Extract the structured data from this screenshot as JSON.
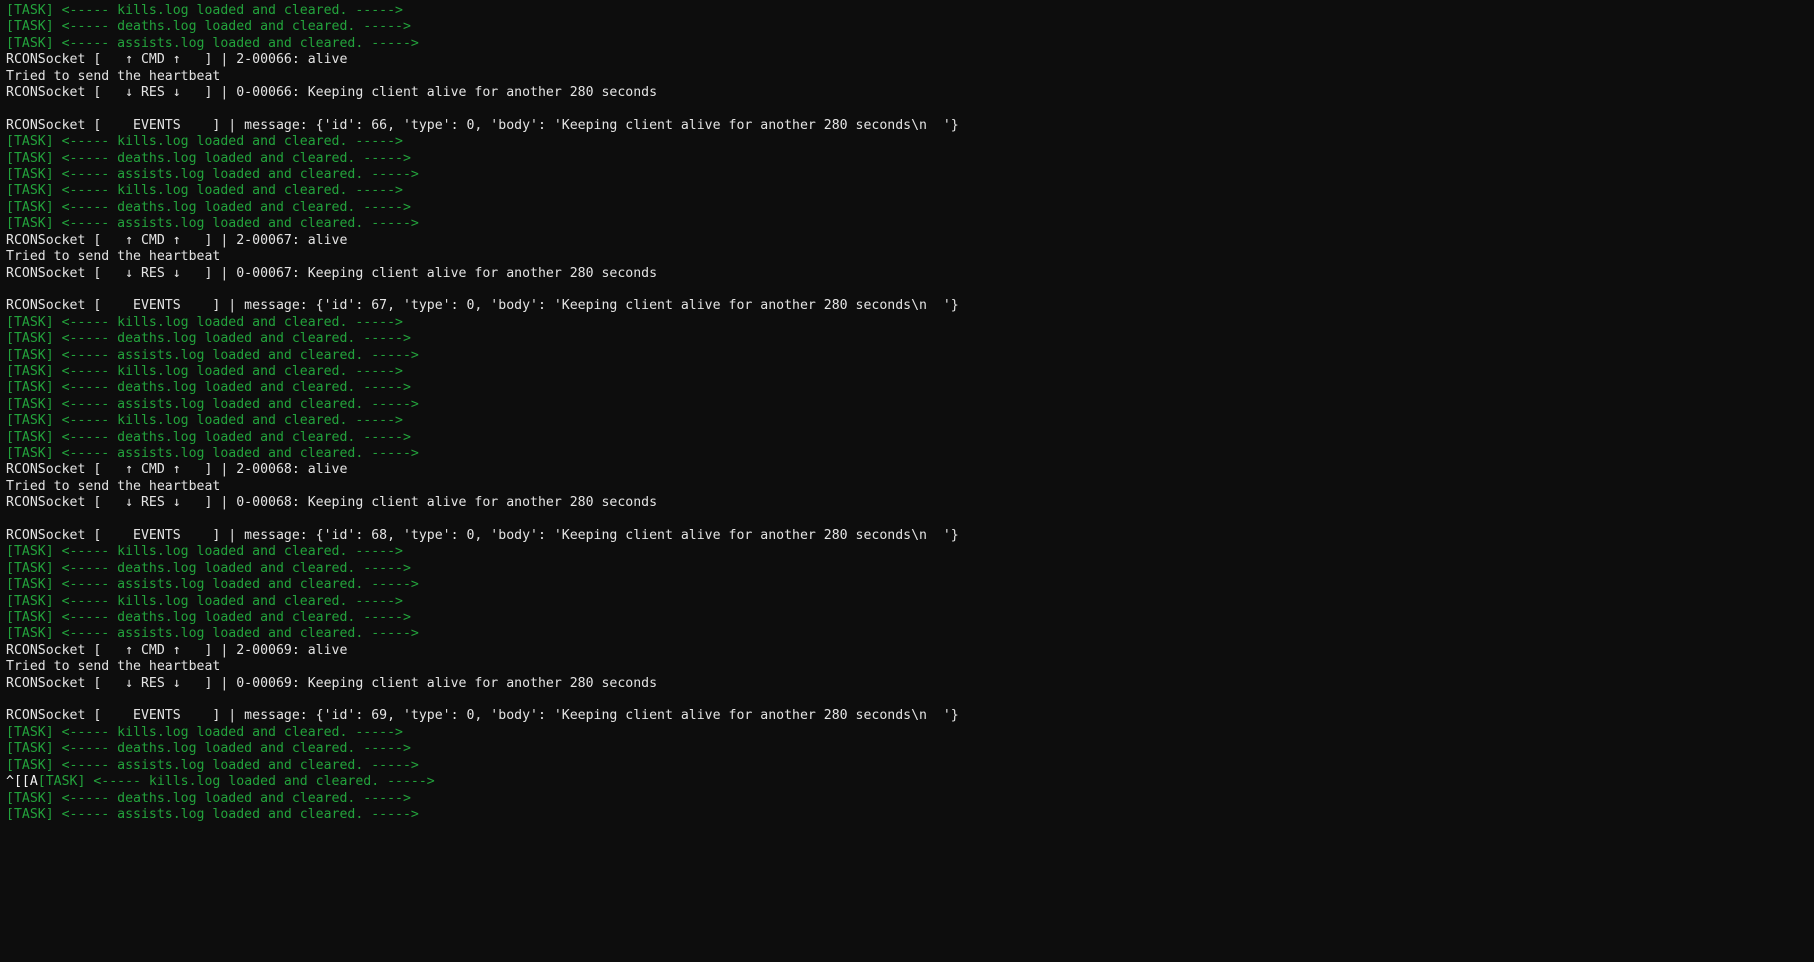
{
  "terminal": {
    "background_color": "#0d0d0d",
    "task_color": "#23a33c",
    "plain_color": "#e4e4e4",
    "escape_color": "#f2f2f2",
    "font_size_px": 13.2,
    "line_height_px": 16.42,
    "columns_visible": 120,
    "rows_visible": 59
  },
  "lines": [
    {
      "type": "task",
      "text": "[TASK] <----- kills.log loaded and cleared. ----->"
    },
    {
      "type": "task",
      "text": "[TASK] <----- deaths.log loaded and cleared. ----->"
    },
    {
      "type": "task",
      "text": "[TASK] <----- assists.log loaded and cleared. ----->"
    },
    {
      "type": "plain",
      "text": "RCONSocket [   ↑ CMD ↑   ] | 2-00066: alive"
    },
    {
      "type": "plain",
      "text": "Tried to send the heartbeat"
    },
    {
      "type": "plain",
      "text": "RCONSocket [   ↓ RES ↓   ] | 0-00066: Keeping client alive for another 280 seconds"
    },
    {
      "type": "blank",
      "text": ""
    },
    {
      "type": "plain",
      "text": "RCONSocket [    EVENTS    ] | message: {'id': 66, 'type': 0, 'body': 'Keeping client alive for another 280 seconds\\n  '}"
    },
    {
      "type": "task",
      "text": "[TASK] <----- kills.log loaded and cleared. ----->"
    },
    {
      "type": "task",
      "text": "[TASK] <----- deaths.log loaded and cleared. ----->"
    },
    {
      "type": "task",
      "text": "[TASK] <----- assists.log loaded and cleared. ----->"
    },
    {
      "type": "task",
      "text": "[TASK] <----- kills.log loaded and cleared. ----->"
    },
    {
      "type": "task",
      "text": "[TASK] <----- deaths.log loaded and cleared. ----->"
    },
    {
      "type": "task",
      "text": "[TASK] <----- assists.log loaded and cleared. ----->"
    },
    {
      "type": "plain",
      "text": "RCONSocket [   ↑ CMD ↑   ] | 2-00067: alive"
    },
    {
      "type": "plain",
      "text": "Tried to send the heartbeat"
    },
    {
      "type": "plain",
      "text": "RCONSocket [   ↓ RES ↓   ] | 0-00067: Keeping client alive for another 280 seconds"
    },
    {
      "type": "blank",
      "text": ""
    },
    {
      "type": "plain",
      "text": "RCONSocket [    EVENTS    ] | message: {'id': 67, 'type': 0, 'body': 'Keeping client alive for another 280 seconds\\n  '}"
    },
    {
      "type": "task",
      "text": "[TASK] <----- kills.log loaded and cleared. ----->"
    },
    {
      "type": "task",
      "text": "[TASK] <----- deaths.log loaded and cleared. ----->"
    },
    {
      "type": "task",
      "text": "[TASK] <----- assists.log loaded and cleared. ----->"
    },
    {
      "type": "task",
      "text": "[TASK] <----- kills.log loaded and cleared. ----->"
    },
    {
      "type": "task",
      "text": "[TASK] <----- deaths.log loaded and cleared. ----->"
    },
    {
      "type": "task",
      "text": "[TASK] <----- assists.log loaded and cleared. ----->"
    },
    {
      "type": "task",
      "text": "[TASK] <----- kills.log loaded and cleared. ----->"
    },
    {
      "type": "task",
      "text": "[TASK] <----- deaths.log loaded and cleared. ----->"
    },
    {
      "type": "task",
      "text": "[TASK] <----- assists.log loaded and cleared. ----->"
    },
    {
      "type": "plain",
      "text": "RCONSocket [   ↑ CMD ↑   ] | 2-00068: alive"
    },
    {
      "type": "plain",
      "text": "Tried to send the heartbeat"
    },
    {
      "type": "plain",
      "text": "RCONSocket [   ↓ RES ↓   ] | 0-00068: Keeping client alive for another 280 seconds"
    },
    {
      "type": "blank",
      "text": ""
    },
    {
      "type": "plain",
      "text": "RCONSocket [    EVENTS    ] | message: {'id': 68, 'type': 0, 'body': 'Keeping client alive for another 280 seconds\\n  '}"
    },
    {
      "type": "task",
      "text": "[TASK] <----- kills.log loaded and cleared. ----->"
    },
    {
      "type": "task",
      "text": "[TASK] <----- deaths.log loaded and cleared. ----->"
    },
    {
      "type": "task",
      "text": "[TASK] <----- assists.log loaded and cleared. ----->"
    },
    {
      "type": "task",
      "text": "[TASK] <----- kills.log loaded and cleared. ----->"
    },
    {
      "type": "task",
      "text": "[TASK] <----- deaths.log loaded and cleared. ----->"
    },
    {
      "type": "task",
      "text": "[TASK] <----- assists.log loaded and cleared. ----->"
    },
    {
      "type": "plain",
      "text": "RCONSocket [   ↑ CMD ↑   ] | 2-00069: alive"
    },
    {
      "type": "plain",
      "text": "Tried to send the heartbeat"
    },
    {
      "type": "plain",
      "text": "RCONSocket [   ↓ RES ↓   ] | 0-00069: Keeping client alive for another 280 seconds"
    },
    {
      "type": "blank",
      "text": ""
    },
    {
      "type": "plain",
      "text": "RCONSocket [    EVENTS    ] | message: {'id': 69, 'type': 0, 'body': 'Keeping client alive for another 280 seconds\\n  '}"
    },
    {
      "type": "task",
      "text": "[TASK] <----- kills.log loaded and cleared. ----->"
    },
    {
      "type": "task",
      "text": "[TASK] <----- deaths.log loaded and cleared. ----->"
    },
    {
      "type": "task",
      "text": "[TASK] <----- assists.log loaded and cleared. ----->"
    },
    {
      "type": "mixed",
      "escape": "^[[A",
      "text": "[TASK] <----- kills.log loaded and cleared. ----->"
    },
    {
      "type": "task",
      "text": "[TASK] <----- deaths.log loaded and cleared. ----->"
    },
    {
      "type": "task",
      "text": "[TASK] <----- assists.log loaded and cleared. ----->"
    }
  ]
}
